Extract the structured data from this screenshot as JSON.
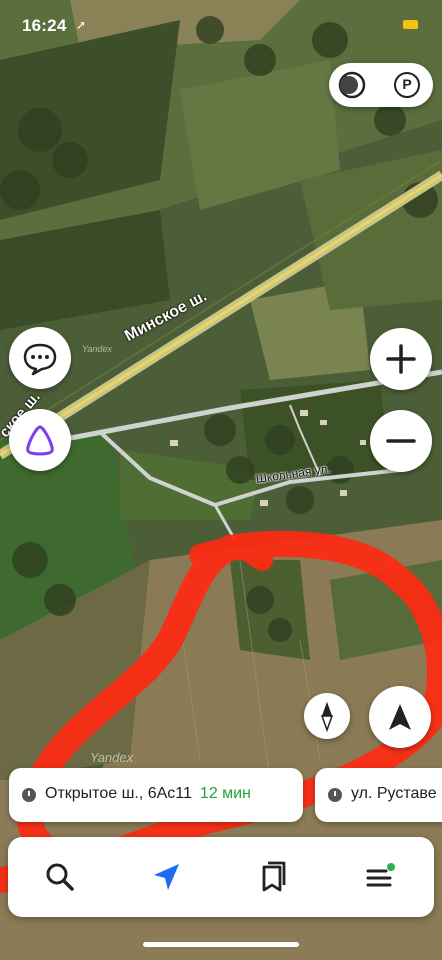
{
  "status_bar": {
    "time": "16:24",
    "location_arrow": "➚"
  },
  "map": {
    "road_main": "Минское ш.",
    "road_main_partial": "ское ш.",
    "street": "Школьная ул.",
    "watermarks": [
      "Yandex",
      "Yandex"
    ],
    "marker_color": "#ff2a12"
  },
  "top_controls": {
    "layers_icon": "layers-icon",
    "parking_label": "P"
  },
  "map_buttons": {
    "chat_icon": "chat-icon",
    "alice_icon": "alice-icon",
    "zoom_in": "+",
    "zoom_out": "−",
    "compass_icon": "compass-icon",
    "locate_icon": "navigation-arrow-icon"
  },
  "suggestions": [
    {
      "address": "Открытое ш., 6Ас11",
      "eta": "12 мин"
    },
    {
      "address": "ул. Руставе"
    }
  ],
  "bottom_bar": {
    "items": [
      "search-icon",
      "route-icon",
      "bookmarks-icon",
      "menu-icon"
    ],
    "accent_color": "#1f6bf2",
    "notify_dot_color": "#2bb34a"
  }
}
